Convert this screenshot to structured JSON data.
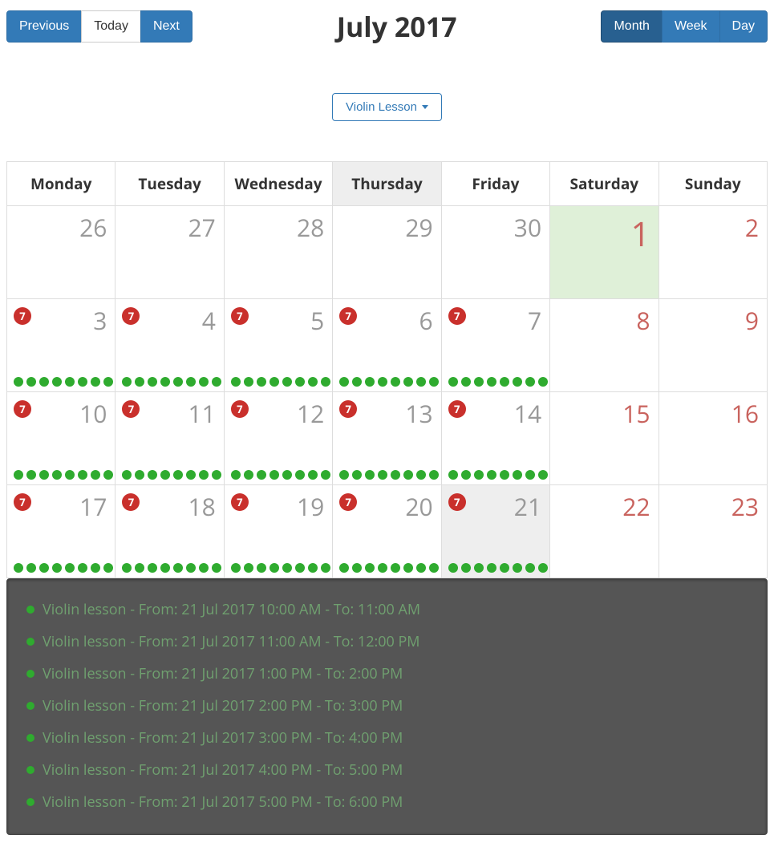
{
  "nav": {
    "previous": "Previous",
    "today": "Today",
    "next": "Next"
  },
  "title": "July 2017",
  "views": {
    "month": "Month",
    "week": "Week",
    "day": "Day",
    "active": "month"
  },
  "filter": {
    "label": "Violin Lesson"
  },
  "weekdays": [
    "Monday",
    "Tuesday",
    "Wednesday",
    "Thursday",
    "Friday",
    "Saturday",
    "Sunday"
  ],
  "highlight_weekday_index": 3,
  "weeks": [
    [
      {
        "day": "26",
        "other": true
      },
      {
        "day": "27",
        "other": true
      },
      {
        "day": "28",
        "other": true
      },
      {
        "day": "29",
        "other": true
      },
      {
        "day": "30",
        "other": true
      },
      {
        "day": "1",
        "red": true,
        "today": true,
        "big": true
      },
      {
        "day": "2",
        "red": true
      }
    ],
    [
      {
        "day": "3",
        "badge": "7",
        "dots": 8
      },
      {
        "day": "4",
        "badge": "7",
        "dots": 8
      },
      {
        "day": "5",
        "badge": "7",
        "dots": 8
      },
      {
        "day": "6",
        "badge": "7",
        "dots": 8
      },
      {
        "day": "7",
        "badge": "7",
        "dots": 8
      },
      {
        "day": "8",
        "red": true
      },
      {
        "day": "9",
        "red": true
      }
    ],
    [
      {
        "day": "10",
        "badge": "7",
        "dots": 8
      },
      {
        "day": "11",
        "badge": "7",
        "dots": 8
      },
      {
        "day": "12",
        "badge": "7",
        "dots": 8
      },
      {
        "day": "13",
        "badge": "7",
        "dots": 8
      },
      {
        "day": "14",
        "badge": "7",
        "dots": 8
      },
      {
        "day": "15",
        "red": true
      },
      {
        "day": "16",
        "red": true
      }
    ],
    [
      {
        "day": "17",
        "badge": "7",
        "dots": 8
      },
      {
        "day": "18",
        "badge": "7",
        "dots": 8
      },
      {
        "day": "19",
        "badge": "7",
        "dots": 8
      },
      {
        "day": "20",
        "badge": "7",
        "dots": 8
      },
      {
        "day": "21",
        "badge": "7",
        "dots": 8,
        "selected": true
      },
      {
        "day": "22",
        "red": true
      },
      {
        "day": "23",
        "red": true
      }
    ]
  ],
  "detail": {
    "items": [
      "Violin lesson - From: 21 Jul 2017 10:00 AM - To: 11:00 AM",
      "Violin lesson - From: 21 Jul 2017 11:00 AM - To: 12:00 PM",
      "Violin lesson - From: 21 Jul 2017 1:00 PM - To: 2:00 PM",
      "Violin lesson - From: 21 Jul 2017 2:00 PM - To: 3:00 PM",
      "Violin lesson - From: 21 Jul 2017 3:00 PM - To: 4:00 PM",
      "Violin lesson - From: 21 Jul 2017 4:00 PM - To: 5:00 PM",
      "Violin lesson - From: 21 Jul 2017 5:00 PM - To: 6:00 PM"
    ]
  }
}
